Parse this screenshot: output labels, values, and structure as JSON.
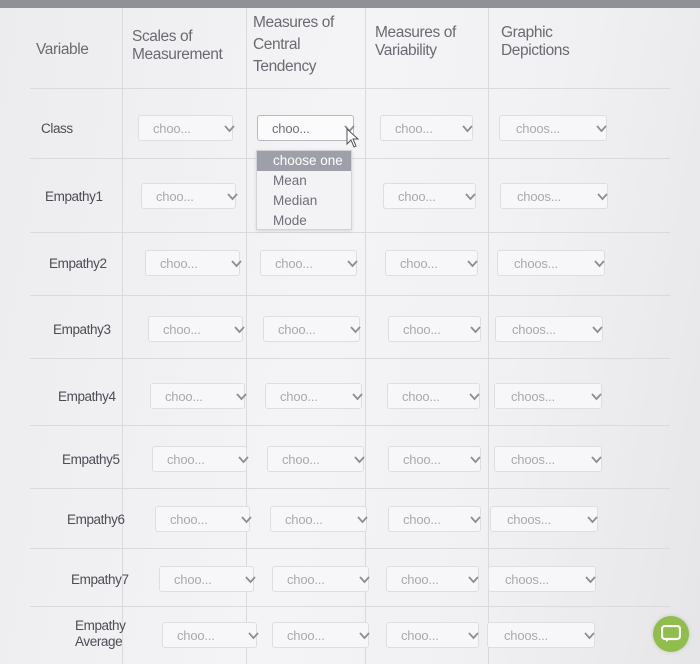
{
  "headers": {
    "variable": "Variable",
    "scales": [
      "Scales of",
      "Measurement"
    ],
    "central": [
      "Measures of",
      "Central",
      "Tendency"
    ],
    "variability": [
      "Measures of",
      "Variability"
    ],
    "graphic": [
      "Graphic",
      "Depictions"
    ]
  },
  "rows": [
    {
      "label": [
        "Class"
      ],
      "cells": [
        "choo...",
        "choo...",
        "choo...",
        "choos..."
      ]
    },
    {
      "label": [
        "Empathy1"
      ],
      "cells": [
        "choo...",
        "",
        "choo...",
        "choos..."
      ]
    },
    {
      "label": [
        "Empathy2"
      ],
      "cells": [
        "choo...",
        "choo...",
        "choo...",
        "choos..."
      ]
    },
    {
      "label": [
        "Empathy3"
      ],
      "cells": [
        "choo...",
        "choo...",
        "choo...",
        "choos..."
      ]
    },
    {
      "label": [
        "Empathy4"
      ],
      "cells": [
        "choo...",
        "choo...",
        "choo...",
        "choos..."
      ]
    },
    {
      "label": [
        "Empathy5"
      ],
      "cells": [
        "choo...",
        "choo...",
        "choo...",
        "choos..."
      ]
    },
    {
      "label": [
        "Empathy6"
      ],
      "cells": [
        "choo...",
        "choo...",
        "choo...",
        "choos..."
      ]
    },
    {
      "label": [
        "Empathy7"
      ],
      "cells": [
        "choo...",
        "choo...",
        "choo...",
        "choos..."
      ]
    },
    {
      "label": [
        "Empathy",
        "Average"
      ],
      "cells": [
        "choo...",
        "choo...",
        "choo...",
        "choos..."
      ]
    }
  ],
  "dropdown": {
    "options": [
      "choose one",
      "Mean",
      "Median",
      "Mode"
    ],
    "highlighted": "choose one"
  },
  "icons": {
    "select": "chevron-down-icon",
    "cursor": "mouse-pointer-icon",
    "fab": "chat-icon"
  },
  "colors": {
    "fab": "#8fbe4a",
    "highlight": "#9da0a8"
  }
}
